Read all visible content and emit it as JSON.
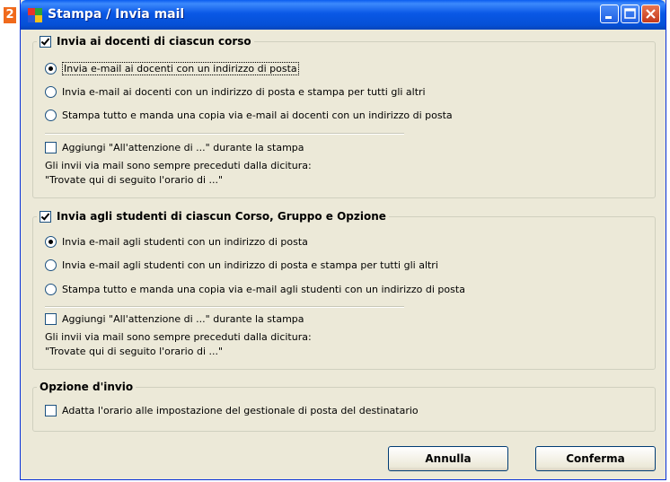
{
  "badge": "2",
  "window": {
    "title": "Stampa / Invia mail"
  },
  "teachers": {
    "title": "Invia ai docenti di ciascun corso",
    "checked": true,
    "options": [
      "Invia e-mail ai docenti con un indirizzo di posta",
      "Invia e-mail ai docenti con un indirizzo di posta e stampa per tutti gli altri",
      "Stampa tutto e manda una copia via e-mail ai docenti con un indirizzo di posta"
    ],
    "selected_option": 0,
    "attention_label": "Aggiungi \"All'attenzione di ...\" durante la stampa",
    "attention_checked": false,
    "note_line1": "Gli invii via mail sono sempre preceduti dalla dicitura:",
    "note_line2": "\"Trovate qui di seguito l'orario di ...\""
  },
  "students": {
    "title": "Invia agli studenti di ciascun Corso, Gruppo e Opzione",
    "checked": true,
    "options": [
      "Invia e-mail agli studenti con un indirizzo di posta",
      "Invia e-mail agli studenti con un indirizzo di posta e stampa per tutti gli altri",
      "Stampa tutto e manda una copia via e-mail agli studenti con un indirizzo di posta"
    ],
    "selected_option": 0,
    "attention_label": "Aggiungi \"All'attenzione di ...\" durante la stampa",
    "attention_checked": false,
    "note_line1": "Gli invii via mail sono sempre preceduti dalla dicitura:",
    "note_line2": "\"Trovate qui di seguito l'orario di ...\""
  },
  "send_options": {
    "title": "Opzione d'invio",
    "adapt_label": "Adatta l'orario alle impostazione del gestionale di posta del destinatario",
    "adapt_checked": false
  },
  "buttons": {
    "cancel": "Annulla",
    "confirm": "Conferma"
  },
  "colors": {
    "title_bar": "#0a58e6",
    "dialog_bg": "#ece9d8",
    "check_green": "#21a121",
    "badge": "#f06a1c"
  }
}
